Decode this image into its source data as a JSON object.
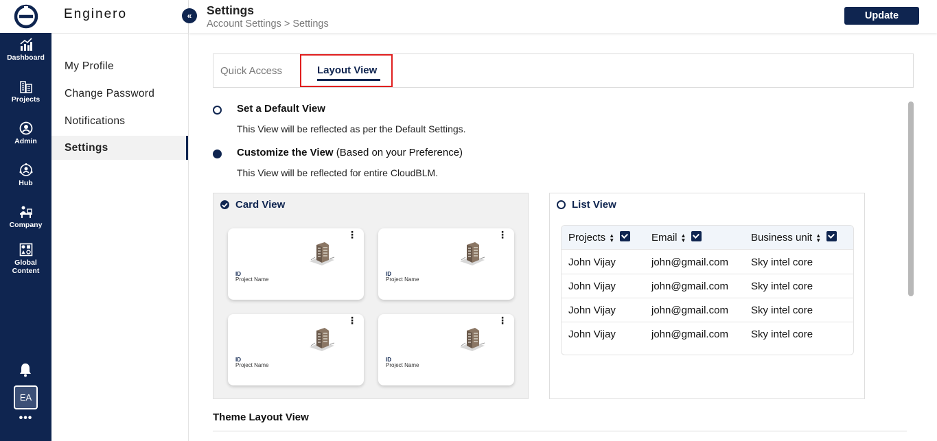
{
  "rail": {
    "items": [
      {
        "label": "Dashboard",
        "icon": "chart-icon"
      },
      {
        "label": "Projects",
        "icon": "buildings-icon"
      },
      {
        "label": "Admin",
        "icon": "admin-icon"
      },
      {
        "label": "Hub",
        "icon": "hub-icon"
      },
      {
        "label": "Company",
        "icon": "company-icon"
      },
      {
        "label": "Global\nContent",
        "icon": "global-content-icon"
      }
    ],
    "avatar": "EA",
    "more": "•••"
  },
  "sidebar": {
    "brand": "Enginero",
    "collapse_icon": "«",
    "items": [
      {
        "label": "My Profile"
      },
      {
        "label": "Change Password"
      },
      {
        "label": "Notifications"
      },
      {
        "label": "Settings"
      }
    ]
  },
  "header": {
    "title": "Settings",
    "breadcrumb": "Account Settings > Settings",
    "update_label": "Update"
  },
  "tabs": {
    "quick_access": "Quick Access",
    "layout_view": "Layout View"
  },
  "options": {
    "default": {
      "title": "Set a Default View",
      "desc": "This View will be reflected as per the Default Settings."
    },
    "custom": {
      "title": "Customize the View",
      "title_suffix": "(Based on your Preference)",
      "desc": "This View will be reflected for entire CloudBLM."
    }
  },
  "card_view": {
    "title": "Card View",
    "cards": [
      {
        "id": "ID",
        "name": "Project Name"
      },
      {
        "id": "ID",
        "name": "Project Name"
      },
      {
        "id": "ID",
        "name": "Project Name"
      },
      {
        "id": "ID",
        "name": "Project Name"
      }
    ]
  },
  "list_view": {
    "title": "List View",
    "columns": [
      "Projects",
      "Email",
      "Business unit"
    ],
    "rows": [
      [
        "John Vijay",
        "john@gmail.com",
        "Sky intel core"
      ],
      [
        "John Vijay",
        "john@gmail.com",
        "Sky intel core"
      ],
      [
        "John Vijay",
        "john@gmail.com",
        "Sky intel core"
      ],
      [
        "John Vijay",
        "john@gmail.com",
        "Sky intel core"
      ]
    ]
  },
  "theme_layout": {
    "title": "Theme Layout View"
  },
  "colors": {
    "primary": "#0f2550",
    "highlight": "#e01e1e"
  }
}
